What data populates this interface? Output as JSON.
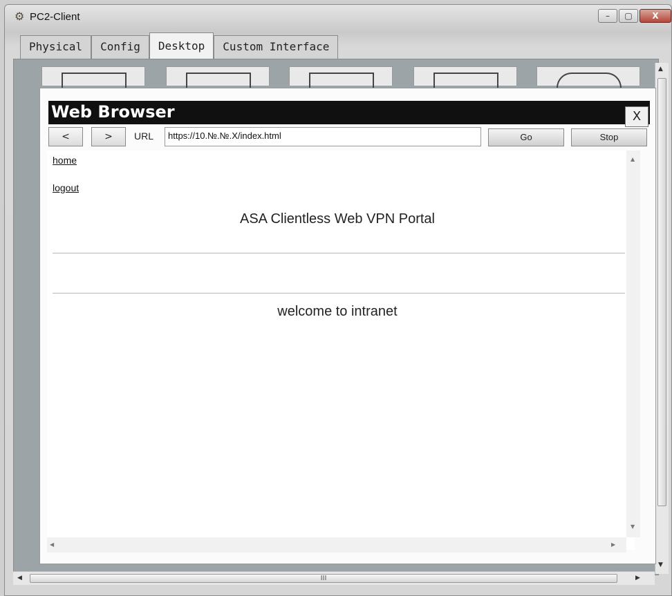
{
  "window": {
    "title": "PC2-Client",
    "controls": {
      "minimize": "–",
      "maximize": "▢",
      "close": "X"
    }
  },
  "tabs": [
    {
      "label": "Physical",
      "active": false
    },
    {
      "label": "Config",
      "active": false
    },
    {
      "label": "Desktop",
      "active": true
    },
    {
      "label": "Custom Interface",
      "active": false
    }
  ],
  "browser": {
    "title": "Web Browser",
    "close_label": "X",
    "back_label": "<",
    "forward_label": ">",
    "url_label": "URL",
    "url_value": "https://10.№.№.X/index.html",
    "go_label": "Go",
    "stop_label": "Stop"
  },
  "page": {
    "links": [
      "home",
      "logout"
    ],
    "portal_title": "ASA Clientless Web VPN Portal",
    "welcome_text": "welcome to intranet"
  },
  "scrollbar": {
    "h_grip": "III"
  }
}
